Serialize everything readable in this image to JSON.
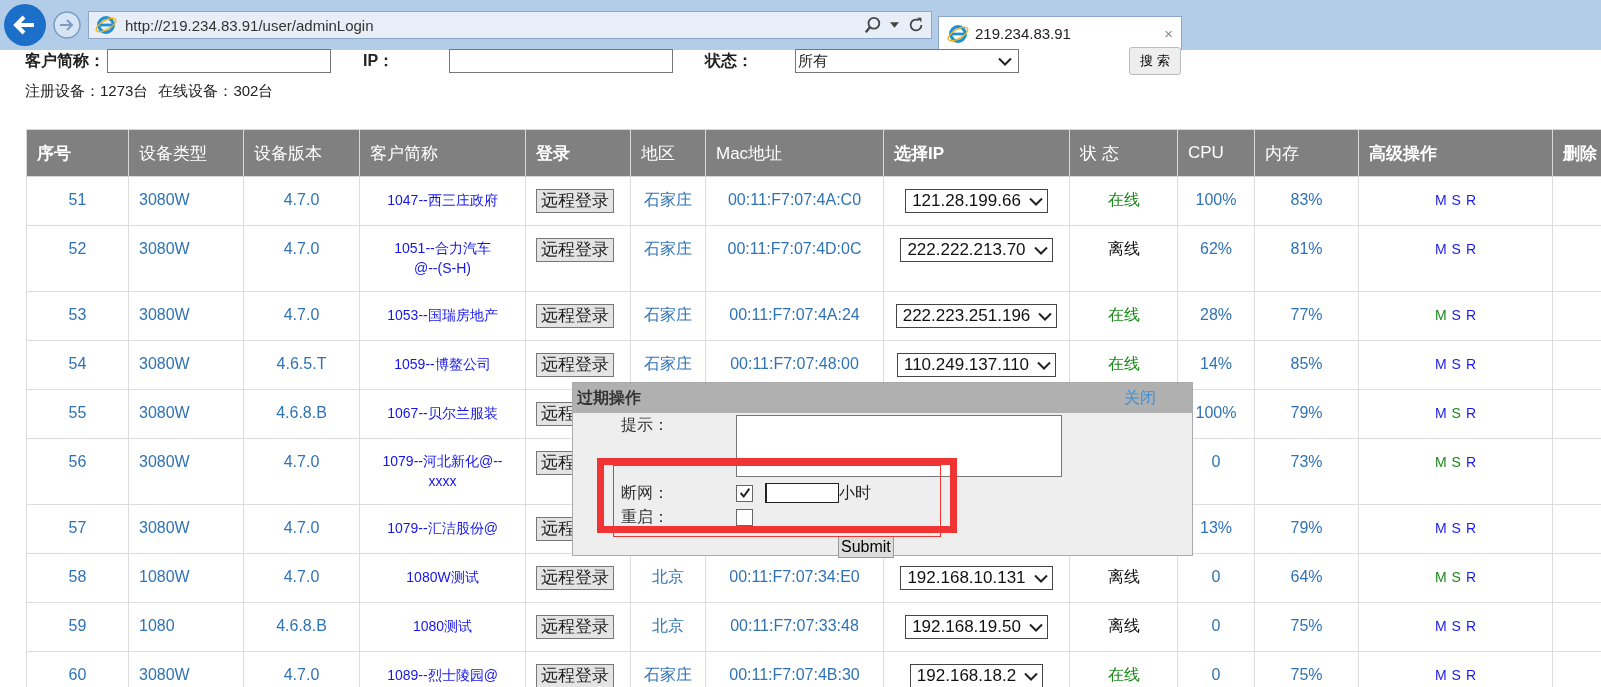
{
  "browser": {
    "url": "http://219.234.83.91/user/adminLogin",
    "tab_title": "219.234.83.91",
    "tab_close": "×"
  },
  "filters": [
    {
      "label": "客户简称：",
      "kind": "input"
    },
    {
      "label": "IP：",
      "kind": "input"
    },
    {
      "label": "状态：",
      "kind": "select",
      "value": "所有"
    }
  ],
  "search_button": "搜 索",
  "stats": [
    "注册设备：1273台",
    "在线设备：302台"
  ],
  "table": {
    "columns": [
      {
        "label": "序号",
        "bold": true
      },
      {
        "label": "设备类型",
        "bold": false
      },
      {
        "label": "设备版本",
        "bold": false
      },
      {
        "label": "客户简称",
        "bold": false
      },
      {
        "label": "登录",
        "bold": true
      },
      {
        "label": "地区",
        "bold": false
      },
      {
        "label": "Mac地址",
        "bold": false
      },
      {
        "label": "选择IP",
        "bold": true
      },
      {
        "label": "状 态",
        "bold": false
      },
      {
        "label": "CPU",
        "bold": false
      },
      {
        "label": "内存",
        "bold": false
      },
      {
        "label": "高级操作",
        "bold": true
      },
      {
        "label": "删除",
        "bold": true
      }
    ],
    "rows": [
      {
        "no": "51",
        "type": "3080W",
        "version": "4.7.0",
        "customer": "1047--西三庄政府",
        "login": "远程登录",
        "region": "石家庄",
        "mac": "00:11:F7:07:4A:C0",
        "ip": "121.28.199.66",
        "status": "在线",
        "online": true,
        "cpu": "100%",
        "mem": "83%",
        "actions": [
          {
            "label": "M",
            "active": false
          },
          {
            "label": "S",
            "active": false
          },
          {
            "label": "R",
            "active": false
          }
        ]
      },
      {
        "no": "52",
        "type": "3080W",
        "version": "4.7.0",
        "customer": "1051--合力汽车\n@--(S-H)",
        "login": "远程登录",
        "region": "石家庄",
        "mac": "00:11:F7:07:4D:0C",
        "ip": "222.222.213.70",
        "status": "离线",
        "online": false,
        "cpu": "62%",
        "mem": "81%",
        "actions": [
          {
            "label": "M",
            "active": false
          },
          {
            "label": "S",
            "active": false
          },
          {
            "label": "R",
            "active": false
          }
        ]
      },
      {
        "no": "53",
        "type": "3080W",
        "version": "4.7.0",
        "customer": "1053--国瑞房地产",
        "login": "远程登录",
        "region": "石家庄",
        "mac": "00:11:F7:07:4A:24",
        "ip": "222.223.251.196",
        "status": "在线",
        "online": true,
        "cpu": "28%",
        "mem": "77%",
        "actions": [
          {
            "label": "M",
            "active": true
          },
          {
            "label": "S",
            "active": false
          },
          {
            "label": "R",
            "active": false
          }
        ]
      },
      {
        "no": "54",
        "type": "3080W",
        "version": "4.6.5.T",
        "customer": "1059--博鳌公司",
        "login": "远程登录",
        "region": "石家庄",
        "mac": "00:11:F7:07:48:00",
        "ip": "110.249.137.110",
        "status": "在线",
        "online": true,
        "cpu": "14%",
        "mem": "85%",
        "actions": [
          {
            "label": "M",
            "active": false
          },
          {
            "label": "S",
            "active": false
          },
          {
            "label": "R",
            "active": false
          }
        ]
      },
      {
        "no": "55",
        "type": "3080W",
        "version": "4.6.8.B",
        "customer": "1067--贝尔兰服装",
        "login": "远程",
        "cpu": "100%",
        "mem": "79%",
        "actions": [
          {
            "label": "M",
            "active": false
          },
          {
            "label": "S",
            "active": true
          },
          {
            "label": "R",
            "active": false
          }
        ]
      },
      {
        "no": "56",
        "type": "3080W",
        "version": "4.7.0",
        "customer": "1079--河北新化@--\nxxxx",
        "login": "远程",
        "cpu": "0",
        "mem": "73%",
        "actions": [
          {
            "label": "M",
            "active": true
          },
          {
            "label": "S",
            "active": true
          },
          {
            "label": "R",
            "active": false
          }
        ]
      },
      {
        "no": "57",
        "type": "3080W",
        "version": "4.7.0",
        "customer": "1079--汇洁股份@",
        "login": "远程",
        "cpu": "13%",
        "mem": "79%",
        "actions": [
          {
            "label": "M",
            "active": false
          },
          {
            "label": "S",
            "active": false
          },
          {
            "label": "R",
            "active": false
          }
        ]
      },
      {
        "no": "58",
        "type": "1080W",
        "version": "4.7.0",
        "customer": "1080W测试",
        "login": "远程登录",
        "region": "北京",
        "mac": "00:11:F7:07:34:E0",
        "ip": "192.168.10.131",
        "status": "离线",
        "online": false,
        "cpu": "0",
        "mem": "64%",
        "actions": [
          {
            "label": "M",
            "active": true
          },
          {
            "label": "S",
            "active": true
          },
          {
            "label": "R",
            "active": false
          }
        ]
      },
      {
        "no": "59",
        "type": "1080",
        "version": "4.6.8.B",
        "customer": "1080测试",
        "login": "远程登录",
        "region": "北京",
        "mac": "00:11:F7:07:33:48",
        "ip": "192.168.19.50",
        "status": "离线",
        "online": false,
        "cpu": "0",
        "mem": "75%",
        "actions": [
          {
            "label": "M",
            "active": false
          },
          {
            "label": "S",
            "active": false
          },
          {
            "label": "R",
            "active": false
          }
        ]
      },
      {
        "no": "60",
        "type": "3080W",
        "version": "4.7.0",
        "customer": "1089--烈士陵园@",
        "login": "远程登录",
        "region": "石家庄",
        "mac": "00:11:F7:07:4B:30",
        "ip": "192.168.18.2",
        "status": "在线",
        "online": true,
        "cpu": "0",
        "mem": "75%",
        "actions": [
          {
            "label": "M",
            "active": false
          },
          {
            "label": "S",
            "active": false
          },
          {
            "label": "R",
            "active": false
          }
        ]
      }
    ]
  },
  "dialog": {
    "title": "过期操作",
    "close": "关闭",
    "fields": [
      {
        "label": "提示：",
        "kind": "textarea"
      },
      {
        "label": "断网：",
        "kind": "checkbox",
        "checked": true,
        "unit": "小时"
      },
      {
        "label": "重启：",
        "kind": "checkbox",
        "checked": false
      }
    ],
    "submit": "Submit"
  }
}
